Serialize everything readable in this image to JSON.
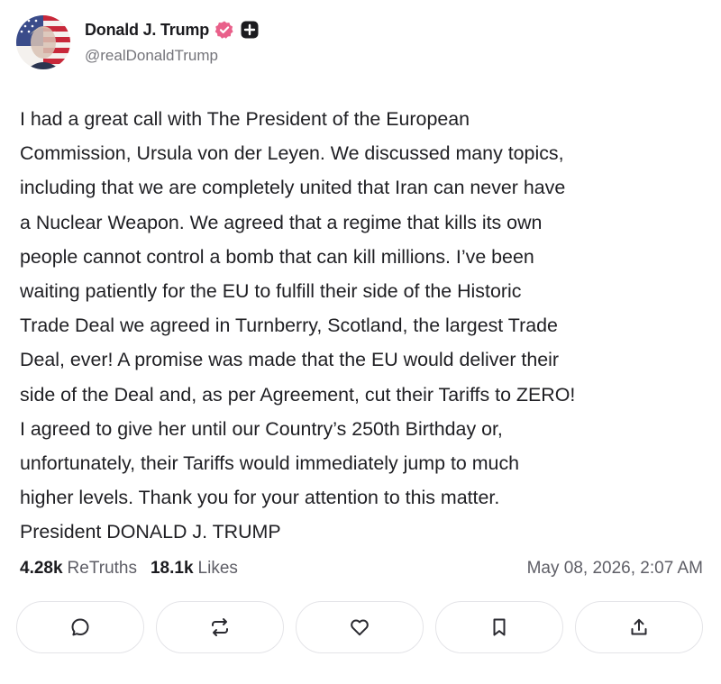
{
  "author": {
    "display_name": "Donald J. Trump",
    "handle": "@realDonaldTrump",
    "verified_badge_icon": "verified-badge-icon",
    "plus_badge_icon": "plus-badge-icon"
  },
  "post": {
    "text": "I had a great call with The President of the European\nCommission, Ursula von der Leyen. We discussed many topics,\nincluding that we are completely united that Iran can never have\na Nuclear Weapon. We agreed that a regime that kills its own\npeople cannot control a bomb that can kill millions. I’ve been\nwaiting patiently for the EU to fulfill their side of the Historic\nTrade Deal we agreed in Turnberry, Scotland, the largest Trade\nDeal, ever! A promise was made that the EU would deliver their\nside of the Deal and, as per Agreement, cut their Tariffs to ZERO!\nI agreed to give her until our Country’s 250th Birthday or,\nunfortunately, their Tariffs would immediately jump to much\nhigher levels. Thank you for your attention to this matter.\nPresident DONALD J. TRUMP"
  },
  "stats": {
    "retruths_count": "4.28k",
    "retruths_label": "ReTruths",
    "likes_count": "18.1k",
    "likes_label": "Likes",
    "timestamp": "May 08, 2026, 2:07 AM"
  },
  "actions": [
    {
      "icon": "reply-icon"
    },
    {
      "icon": "retruth-icon"
    },
    {
      "icon": "like-icon"
    },
    {
      "icon": "bookmark-icon"
    },
    {
      "icon": "share-icon"
    }
  ],
  "colors": {
    "verified_badge": "#e9608a",
    "muted_text": "#74747a",
    "button_border": "#e4e4e8"
  }
}
